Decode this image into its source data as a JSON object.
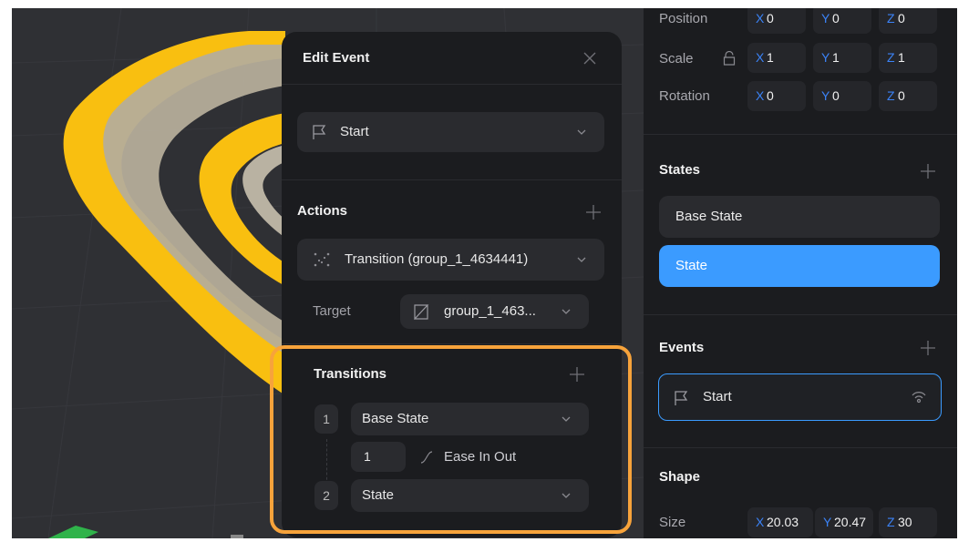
{
  "edit_event": {
    "title": "Edit Event",
    "trigger": "Start",
    "actions_title": "Actions",
    "action_label": "Transition (group_1_4634441)",
    "target_label": "Target",
    "target_value": "group_1_463...",
    "transitions_title": "Transitions",
    "transitions": [
      {
        "index": "1",
        "state": "Base State"
      },
      {
        "index": "2",
        "state": "State"
      }
    ],
    "duration": "1",
    "easing": "Ease In Out"
  },
  "properties": {
    "position": {
      "label": "Position",
      "x": "0",
      "y": "0",
      "z": "0"
    },
    "scale": {
      "label": "Scale",
      "x": "1",
      "y": "1",
      "z": "1"
    },
    "rotation": {
      "label": "Rotation",
      "x": "0",
      "y": "0",
      "z": "0"
    },
    "axis_letters": {
      "x": "X",
      "y": "Y",
      "z": "Z"
    },
    "states_title": "States",
    "states": [
      "Base State",
      "State"
    ],
    "events_title": "Events",
    "event_item": "Start",
    "shape_title": "Shape",
    "size": {
      "label": "Size",
      "x": "20.03",
      "y": "20.47",
      "z": "30"
    }
  },
  "colors": {
    "accent_blue": "#3b9bff",
    "highlight_orange": "#f7a33b",
    "shape_yellow": "#f9bf10"
  }
}
